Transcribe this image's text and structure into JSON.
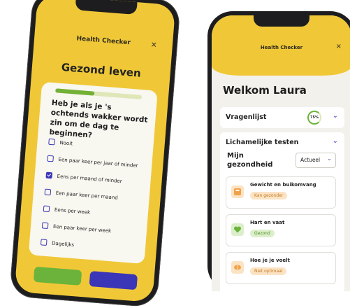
{
  "left_screen": {
    "header_title": "Health Checker",
    "close_glyph": "×",
    "page_heading": "Gezond leven",
    "progress_fraction": 0.45,
    "question": "Heb je als je 's ochtends wakker wordt zin om de dag te beginnen?",
    "options": [
      {
        "label": "Nooit",
        "checked": false
      },
      {
        "label": "Een paar keer per jaar of minder",
        "checked": false
      },
      {
        "label": "Eens per maand of minder",
        "checked": true
      },
      {
        "label": "Een paar keer per maand",
        "checked": false
      },
      {
        "label": "Eens per week",
        "checked": false
      },
      {
        "label": "Een paar keer per week",
        "checked": false
      },
      {
        "label": "Dagelijks",
        "checked": false
      }
    ]
  },
  "right_screen": {
    "header_title": "Health Checker",
    "close_glyph": "×",
    "welcome": "Welkom Laura",
    "rows": [
      {
        "label": "Vragenlijst",
        "percent": "75%"
      },
      {
        "label": "Lichamelijke testen"
      }
    ],
    "health_section": {
      "title": "Mijn gezondheid",
      "select_value": "Actueel",
      "items": [
        {
          "name": "Gewicht en buikomvang",
          "status": "Kan gezonder",
          "icon": "scale-icon",
          "color": "#f0a24a"
        },
        {
          "name": "Hart en vaat",
          "status": "Gezond",
          "icon": "heart-icon",
          "color": "#6cb33b"
        },
        {
          "name": "Hoe je je voelt",
          "status": "Niet optimaal",
          "icon": "brain-icon",
          "color": "#f0a24a"
        }
      ]
    }
  },
  "colors": {
    "brand_yellow": "#f0c837",
    "accent_indigo": "#3b35b7",
    "green": "#6cb33b",
    "orange": "#f0a24a"
  }
}
